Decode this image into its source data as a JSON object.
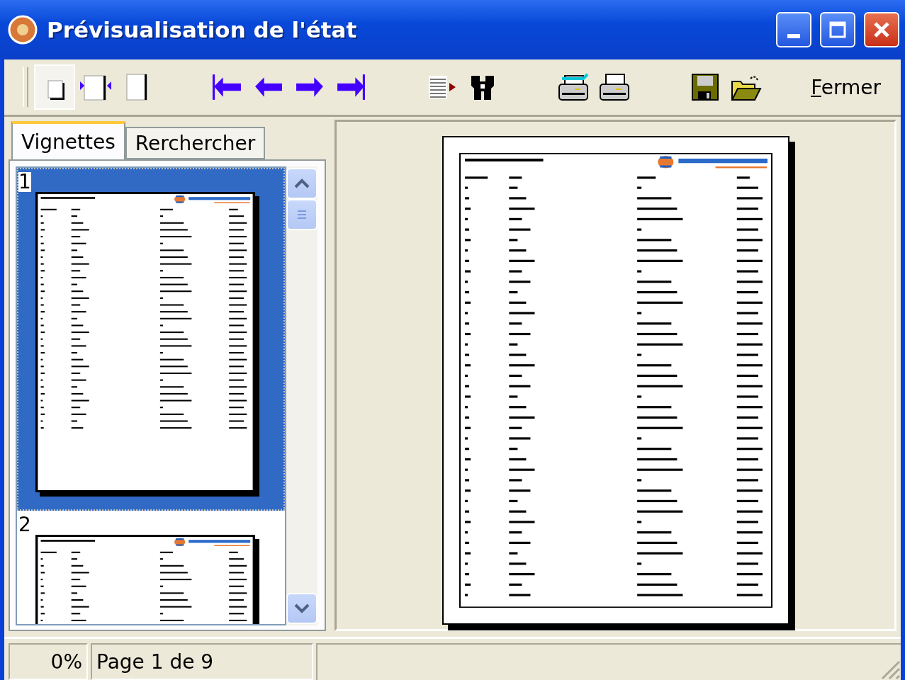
{
  "window": {
    "title": "Prévisualisation de l'état"
  },
  "toolbar": {
    "view_buttons": [
      {
        "kind": "one-page",
        "selected": true
      },
      {
        "kind": "page-width",
        "selected": false
      },
      {
        "kind": "full-page",
        "selected": false
      }
    ],
    "nav_buttons": [
      {
        "kind": "first"
      },
      {
        "kind": "previous"
      },
      {
        "kind": "next"
      },
      {
        "kind": "last"
      }
    ],
    "tool_buttons": [
      {
        "kind": "list"
      },
      {
        "kind": "find"
      }
    ],
    "print_buttons": [
      {
        "kind": "print-setup"
      },
      {
        "kind": "print"
      }
    ],
    "file_buttons": [
      {
        "kind": "save"
      },
      {
        "kind": "open"
      }
    ],
    "close_label": "Fermer"
  },
  "tabs": [
    {
      "label": "Vignettes",
      "selected": true
    },
    {
      "label": "Rerchercher",
      "selected": false
    }
  ],
  "thumbnails": [
    {
      "number": "1",
      "selected": true
    },
    {
      "number": "2",
      "selected": false
    }
  ],
  "status_bar": {
    "progress": "0%",
    "page": "Page 1 de 9"
  }
}
